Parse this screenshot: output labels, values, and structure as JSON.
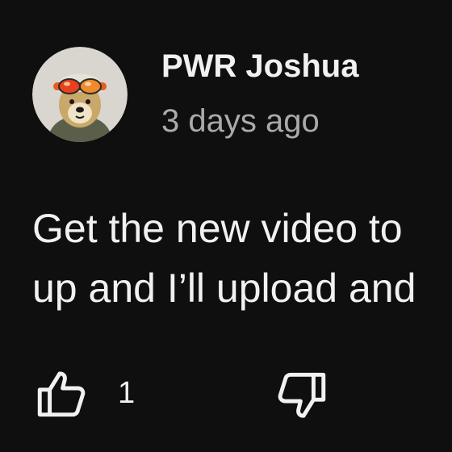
{
  "comment": {
    "author": "PWR Joshua",
    "timestamp": "3 days ago",
    "text_lines": [
      "Get the new video to",
      "up and I’ll upload and"
    ],
    "avatar_icon": "dog-with-goggles-avatar"
  },
  "actions": {
    "like_icon": "thumbs-up-icon",
    "like_count": "1",
    "dislike_icon": "thumbs-down-icon"
  },
  "colors": {
    "background": "#0f0f0f",
    "primary_text": "#f1f1f1",
    "secondary_text": "#aaaaaa"
  }
}
